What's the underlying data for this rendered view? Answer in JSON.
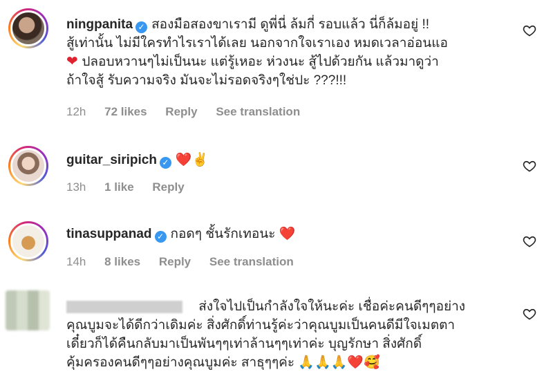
{
  "comments": [
    {
      "username": "ningpanita",
      "verified": true,
      "text_lines": [
        "สองมือสองขาเรามี ดูพี่นี่ ล้มกี่ รอบแล้ว นี่ก็ล้มอยู่ !!",
        "สู้เท่านั้น ไม่มีใครทำไรเราได้เลย นอกจากใจเราเอง หมดเวลาอ่อนแอ",
        "ปลอบหวานๆไม่เป็นนะ แต่รู้เหอะ ห่วงนะ สู้ไปด้วยกัน แล้วมาดูว่า",
        "ถ้าใจสู้ รับความจริง มันจะไม่รอดจริงๆใช่ปะ ???!!!"
      ],
      "time": "12h",
      "likes": "72 likes",
      "reply": "Reply",
      "translate": "See translation"
    },
    {
      "username": "guitar_siripich",
      "verified": true,
      "text": "❤️✌️",
      "time": "13h",
      "likes": "1 like",
      "reply": "Reply"
    },
    {
      "username": "tinasuppanad",
      "verified": true,
      "text": "กอดๆ ชั้นรักเทอนะ ❤️",
      "time": "14h",
      "likes": "8 likes",
      "reply": "Reply",
      "translate": "See translation"
    },
    {
      "username_hidden": true,
      "text_lines": [
        "ส่งใจไปเป็นกำลังใจให้นะค่ะ เชื่อค่ะคนดีๆๆอย่าง",
        "คุณบูมจะได้ดีกว่าเดิมค่ะ สิ่งศักดิ์ท่านรู้ค่ะว่าคุณบูมเป็นคนดีมีใจเมตตา",
        "เดี๋ยวก็ได้คืนกลับมาเป็นพันๆๆเท่าล้านๆๆเท่าค่ะ บุญรักษา สิ่งศักดิ์",
        "คุ้มครองคนดีๆๆอย่างคุณบูมค่ะ สาธุๆๆค่ะ 🙏🙏🙏❤️🥰"
      ]
    }
  ],
  "icons": {
    "verified": "verified-badge-icon",
    "like": "heart-outline-icon"
  },
  "colors": {
    "text": "#262626",
    "meta": "#8e8e8e",
    "verified": "#3897f0",
    "heart": "#e0212f"
  }
}
